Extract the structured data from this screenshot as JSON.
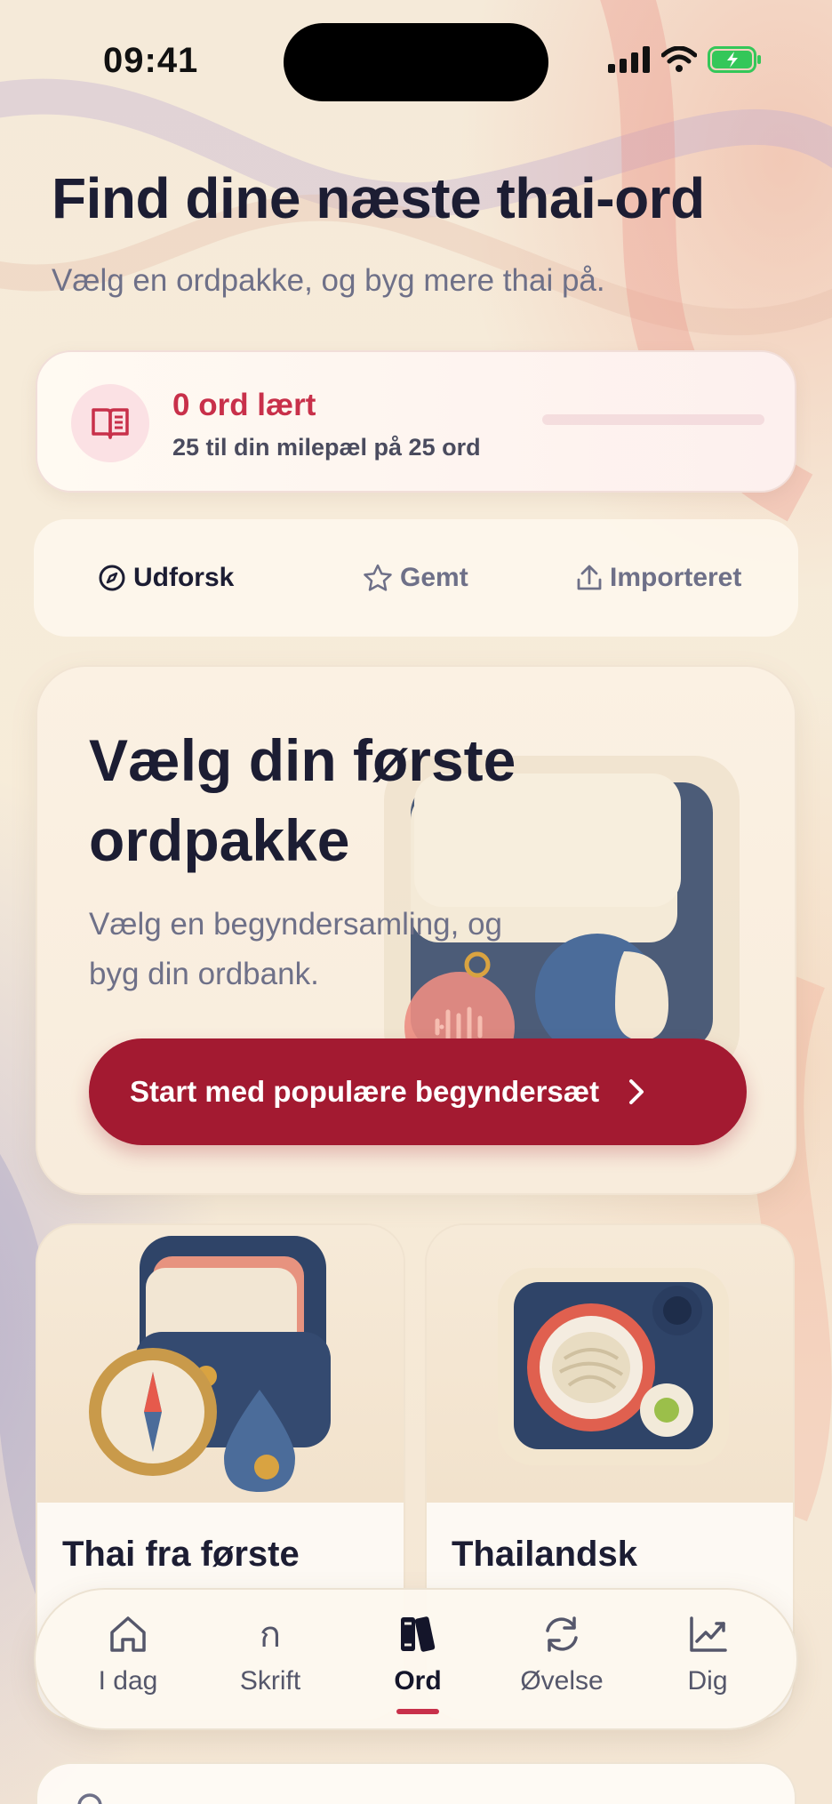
{
  "status_bar": {
    "time": "09:41"
  },
  "header": {
    "title": "Find dine næste thai-ord",
    "subtitle": "Vælg en ordpakke, og byg mere thai på."
  },
  "progress": {
    "main": "0 ord lært",
    "sub": "25 til din milepæl på 25 ord",
    "learned": 0,
    "milestone": 25,
    "accent": "#c8304a"
  },
  "tabs": [
    {
      "label": "Udforsk",
      "icon": "compass-icon",
      "active": true
    },
    {
      "label": "Gemt",
      "icon": "star-icon",
      "active": false
    },
    {
      "label": "Importeret",
      "icon": "upload-icon",
      "active": false
    }
  ],
  "hero": {
    "title": "Vælg din første ordpakke",
    "subtitle": "Vælg en begyndersamling, og byg din ordbank.",
    "button": "Start med populære begyndersæt",
    "button_color": "#a31a31"
  },
  "packs": [
    {
      "title": "Thai fra første"
    },
    {
      "title": "Thailandsk"
    }
  ],
  "nav": [
    {
      "label": "I dag",
      "icon": "home-icon"
    },
    {
      "label": "Skrift",
      "icon": "ก"
    },
    {
      "label": "Ord",
      "icon": "books-icon",
      "active": true
    },
    {
      "label": "Øvelse",
      "icon": "refresh-icon"
    },
    {
      "label": "Dig",
      "icon": "chart-icon"
    }
  ]
}
